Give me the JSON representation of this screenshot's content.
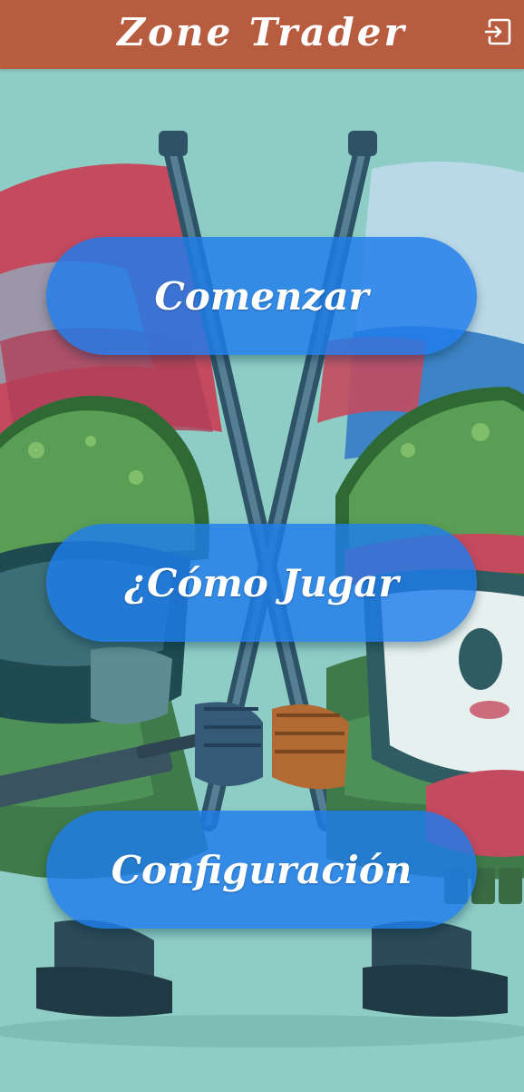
{
  "header": {
    "title": "Zone Trader",
    "exit_icon": "logout-icon",
    "background_color": "#b85c40"
  },
  "menu": {
    "buttons": [
      {
        "label": "Comenzar"
      },
      {
        "label": "¿Cómo Jugar"
      },
      {
        "label": "Configuración"
      }
    ],
    "button_color": "#1e7deb"
  },
  "background": {
    "color": "#8ecdc6",
    "artwork": "two-cartoon-soldiers-fist-bump-crossed-flags"
  }
}
